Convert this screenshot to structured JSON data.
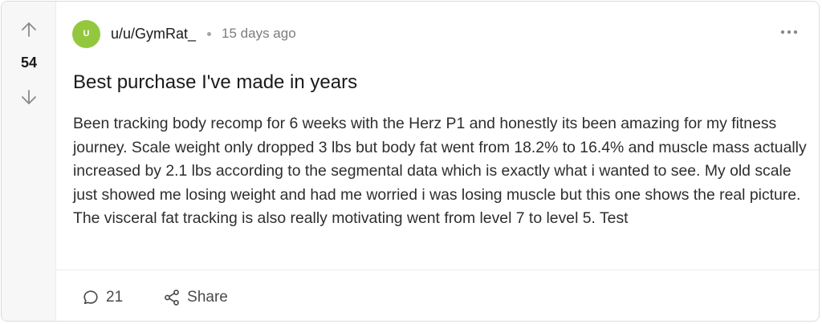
{
  "post": {
    "score": "54",
    "author": {
      "avatar_initial": "U",
      "username": "u/u/GymRat_",
      "avatar_color": "#93c83e"
    },
    "timestamp": "15 days ago",
    "title": "Best purchase I've made in years",
    "body": "Been tracking body recomp for 6 weeks with the Herz P1 and honestly its been amazing for my fitness journey. Scale weight only dropped 3 lbs but body fat went from 18.2% to 16.4% and muscle mass actually increased by 2.1 lbs according to the segmental data which is exactly what i wanted to see. My old scale just showed me losing weight and had me worried i was losing muscle but this one shows the real picture. The visceral fat tracking is also really motivating went from level 7 to level 5. Test"
  },
  "actions": {
    "comments_count": "21",
    "share_label": "Share"
  },
  "icons": {
    "upvote": "arrow-up-icon",
    "downvote": "arrow-down-icon",
    "more": "more-horizontal-icon",
    "comment": "comment-bubble-icon",
    "share": "share-nodes-icon"
  }
}
